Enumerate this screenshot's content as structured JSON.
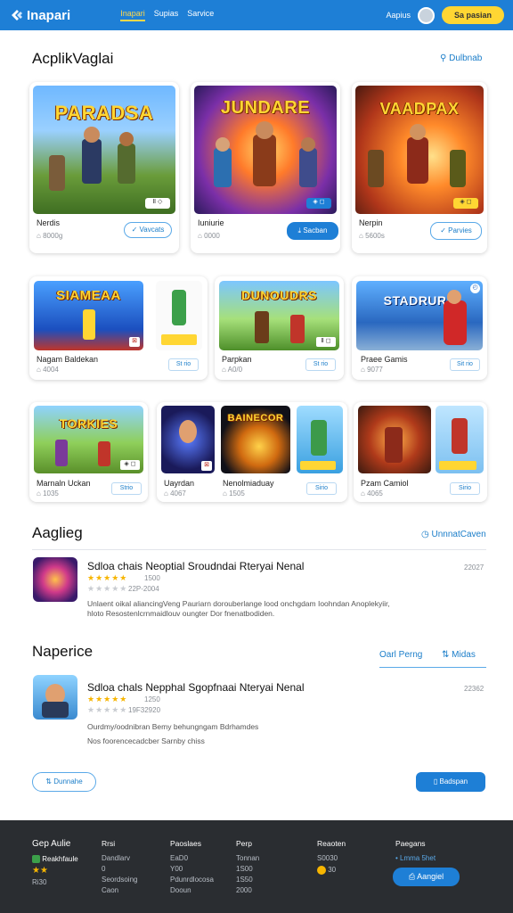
{
  "header": {
    "logo": "Inapari",
    "nav": [
      "Inapari",
      "Supias",
      "Sarvice"
    ],
    "right_link": "Aapius",
    "cta": "Sa pasian"
  },
  "featured": {
    "title": "AcplikVaglai",
    "link": "Dulbnab",
    "cards": [
      {
        "art_title": "PARADSA",
        "name": "Nerdis",
        "sub": "8000g",
        "button": "Vavcats"
      },
      {
        "art_title": "JUNDARE",
        "name": "Iuniurie",
        "sub": "0000",
        "button": "Sacban"
      },
      {
        "art_title": "VAADPAX",
        "name": "Nerpin",
        "sub": "5600s",
        "button": "Parvies"
      }
    ]
  },
  "grid_row1": [
    {
      "art_title": "SIAMEAA",
      "name": "Nagam Baldekan",
      "sub": "4004",
      "button": "St rio"
    },
    {
      "art_title": "DUNOUDRS",
      "name": "Parpkan",
      "sub": "A0/0",
      "button": "St rio"
    },
    {
      "art_title": "STADRURS",
      "name": "Praee Gamis",
      "sub": "9077",
      "button": "Sit rio"
    }
  ],
  "grid_row2": [
    {
      "art_title": "TORKIES",
      "name": "Marnaln Uckan",
      "sub": "1035",
      "button": "Strio"
    },
    {
      "art_title": "BAINECOR",
      "name": "Nenolmiaduay",
      "sub": "1505",
      "name_left": "Uayrdan",
      "sub_left": "4067",
      "button": "Sirio"
    },
    {
      "art_title": "",
      "name": "Pzam Camiol",
      "sub": "4065",
      "button": "Sirio"
    }
  ],
  "ratings": {
    "title": "Aaglieg",
    "link": "UnnnatCaven",
    "review": {
      "title": "Sdloa chais Neoptial Sroudndai Rteryai Nenal",
      "date": "22027",
      "score": "1500",
      "votes": "22P-2004",
      "text1": "Unlaent oikal aliancingVeng Pauriarn dorouberlange lood onchgdam Ioohndan Anoplekyiir,",
      "text2": "hloto Resostenlcrnmaidlouv oungter Dor fnenatbodiden."
    }
  },
  "newest": {
    "title": "Naperice",
    "link1": "Oarl Perng",
    "link2": "Midas",
    "review": {
      "title": "Sdloa chals Nepphal Sgopfnaai Nteryai Nenal",
      "date": "22362",
      "score": "1250",
      "votes": "19F32920",
      "text1": "Ourdmy/oodnibran Bemy behungngam Bdrhamdes",
      "text2": "Nos foorencecadcber Sarnby chiss"
    },
    "left_button": "Dunnahe",
    "right_button": "Badspan"
  },
  "footer": {
    "brand": "Gep Aulie",
    "brand_badge": "Reakhfaule",
    "brand_bottom": "Ri30",
    "cols": [
      {
        "h": "Rrsi",
        "items": [
          "Dandlarv",
          "0",
          "Seordsoing",
          "Caon"
        ]
      },
      {
        "h": "Paoslaes",
        "items": [
          "EaD0",
          "Y00",
          "Pdunrdlocosa",
          "Dooun"
        ]
      },
      {
        "h": "Perp",
        "items": [
          "Tonnan",
          "1S00",
          "1S50",
          "2000"
        ]
      },
      {
        "h": "Reaoten",
        "items": [
          "S0030",
          "",
          "30"
        ]
      },
      {
        "h": "Paegans",
        "items": [
          "Lmma 5het"
        ]
      }
    ],
    "footer_button": "Aangiel"
  },
  "colors": {
    "primary": "#1e7fd6",
    "accent": "#ffd633",
    "footer": "#2a2d31"
  }
}
